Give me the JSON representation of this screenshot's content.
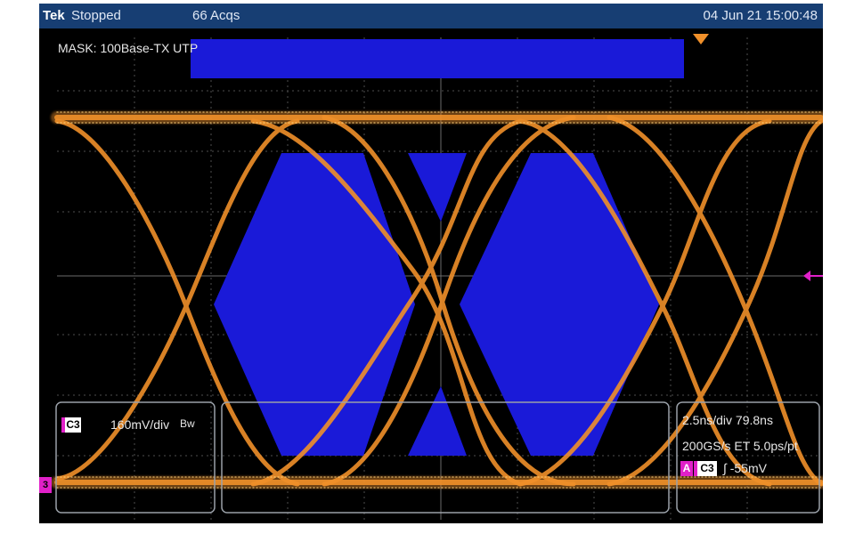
{
  "header": {
    "logo": "Tek",
    "status": "Stopped",
    "acquisitions": "66 Acqs",
    "timestamp": "04 Jun 21 15:00:48"
  },
  "mask": {
    "label": "MASK: 100Base-TX UTP"
  },
  "channel_c3": {
    "badge": "C3",
    "scale": "160mV/div",
    "bandwidth_icon": "Bw",
    "ground_marker": "3"
  },
  "horizontal": {
    "scale": "2.5ns/div  79.8ns",
    "sample_rate": "200GS/s ET 5.0ps/pt"
  },
  "trigger": {
    "source_mark": "A",
    "channel": "C3",
    "level": "∫ -55mV"
  },
  "colors": {
    "waveform": "#f0902a",
    "mask": "#1a1ad8",
    "grid": "#5a5a5a",
    "header": "#173e73",
    "channel_marker": "#e020c8"
  }
}
